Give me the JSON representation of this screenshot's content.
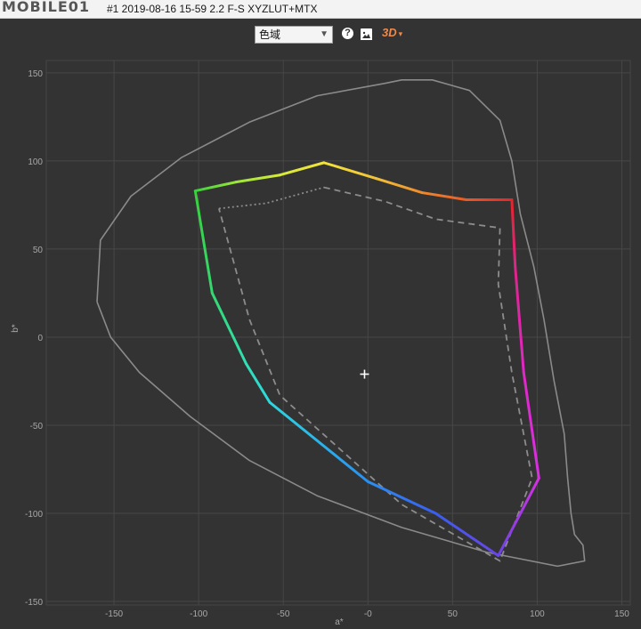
{
  "window": {
    "title": "#1 2019-08-16 15-59 2.2 F-S XYZLUT+MTX",
    "watermark": "MOBILE01"
  },
  "toolbar": {
    "view_select_value": "色域",
    "help_icon": "question-circle-icon",
    "image_icon": "image-icon",
    "threed_label": "3D",
    "threed_caret": "▾"
  },
  "chart_data": {
    "type": "scatter",
    "title": "",
    "xlabel": "a*",
    "ylabel": "b*",
    "xlim": [
      -190,
      155
    ],
    "ylim": [
      -152,
      157
    ],
    "xticks": [
      -150,
      -100,
      -50,
      0,
      50,
      100,
      150
    ],
    "yticks": [
      -150,
      -100,
      -50,
      0,
      50,
      100,
      150
    ],
    "x_tick_labels": [
      "-150",
      "-100",
      "-50",
      "-0",
      "50",
      "100",
      "150"
    ],
    "y_tick_labels": [
      "-150",
      "-100",
      "-50",
      "0",
      "50",
      "100",
      "150"
    ],
    "grid": true,
    "colors": {
      "background": "#333333",
      "grid": "#474747",
      "reference": "#8a8a8a",
      "axis_text": "#a8a8a8"
    },
    "white_point": {
      "x": -2,
      "y": -21
    },
    "series": [
      {
        "style": "solid-gradient",
        "points": [
          {
            "x": -102,
            "y": 83,
            "color": "#39d13b"
          },
          {
            "x": -78,
            "y": 88,
            "color": "#9be53a"
          },
          {
            "x": -52,
            "y": 92,
            "color": "#d6ea3a"
          },
          {
            "x": -26,
            "y": 99,
            "color": "#f2e33a"
          },
          {
            "x": 5,
            "y": 90,
            "color": "#f0c23a"
          },
          {
            "x": 32,
            "y": 82,
            "color": "#ee8a2c"
          },
          {
            "x": 58,
            "y": 78,
            "color": "#e95a28"
          },
          {
            "x": 85,
            "y": 78,
            "color": "#e3262a"
          },
          {
            "x": 87,
            "y": 40,
            "color": "#e0248a"
          },
          {
            "x": 92,
            "y": -20,
            "color": "#e028c8"
          },
          {
            "x": 101,
            "y": -80,
            "color": "#d730e2"
          },
          {
            "x": 77,
            "y": -124,
            "color": "#6a45e6"
          },
          {
            "x": 40,
            "y": -100,
            "color": "#3a5ef0"
          },
          {
            "x": 0,
            "y": -82,
            "color": "#2a8ff2"
          },
          {
            "x": -58,
            "y": -37,
            "color": "#2dd8e0"
          },
          {
            "x": -72,
            "y": -15,
            "color": "#30e0b4"
          },
          {
            "x": -92,
            "y": 25,
            "color": "#34d870"
          },
          {
            "x": -102,
            "y": 83,
            "color": "#39d13b"
          }
        ]
      },
      {
        "style": "dashed",
        "points": [
          {
            "x": -26,
            "y": 85
          },
          {
            "x": 10,
            "y": 77
          },
          {
            "x": 40,
            "y": 67
          },
          {
            "x": 78,
            "y": 62
          },
          {
            "x": 77,
            "y": 30
          },
          {
            "x": 85,
            "y": -20
          },
          {
            "x": 97,
            "y": -80
          },
          {
            "x": 78,
            "y": -127
          },
          {
            "x": 20,
            "y": -95
          },
          {
            "x": -52,
            "y": -33
          },
          {
            "x": -70,
            "y": 10
          },
          {
            "x": -88,
            "y": 73
          }
        ]
      },
      {
        "style": "dotted",
        "points": [
          {
            "x": -88,
            "y": 73
          },
          {
            "x": -60,
            "y": 76
          },
          {
            "x": -26,
            "y": 85
          }
        ]
      },
      {
        "style": "reference-locus",
        "points": [
          {
            "x": -160,
            "y": 20
          },
          {
            "x": -158,
            "y": 55
          },
          {
            "x": -140,
            "y": 80
          },
          {
            "x": -110,
            "y": 102
          },
          {
            "x": -70,
            "y": 122
          },
          {
            "x": -30,
            "y": 137
          },
          {
            "x": 10,
            "y": 144
          },
          {
            "x": 20,
            "y": 146
          },
          {
            "x": 38,
            "y": 146
          },
          {
            "x": 60,
            "y": 140
          },
          {
            "x": 78,
            "y": 123
          },
          {
            "x": 85,
            "y": 100
          },
          {
            "x": 90,
            "y": 70
          },
          {
            "x": 98,
            "y": 40
          },
          {
            "x": 104,
            "y": 10
          },
          {
            "x": 110,
            "y": -25
          },
          {
            "x": 116,
            "y": -55
          },
          {
            "x": 118,
            "y": -80
          },
          {
            "x": 120,
            "y": -100
          },
          {
            "x": 122,
            "y": -112
          },
          {
            "x": 127,
            "y": -118
          },
          {
            "x": 128,
            "y": -127
          },
          {
            "x": 112,
            "y": -130
          },
          {
            "x": 70,
            "y": -122
          },
          {
            "x": 20,
            "y": -108
          },
          {
            "x": -30,
            "y": -90
          },
          {
            "x": -70,
            "y": -70
          },
          {
            "x": -105,
            "y": -45
          },
          {
            "x": -135,
            "y": -20
          },
          {
            "x": -152,
            "y": 0
          },
          {
            "x": -160,
            "y": 20
          }
        ]
      }
    ]
  }
}
